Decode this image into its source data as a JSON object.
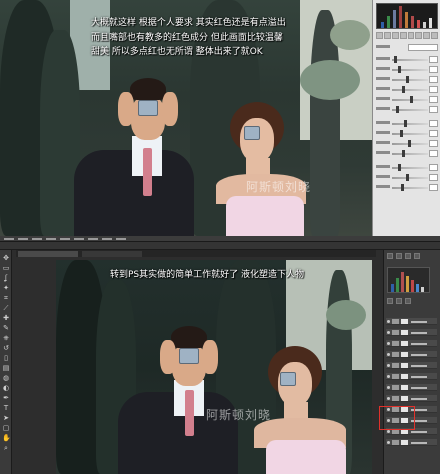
{
  "camera_raw": {
    "caption_lines": [
      "大概就这样  根据个人要求  其实红色还是有点溢出",
      "而且嘴部也有教多的红色成分  但此画面比较温馨",
      "甜美  所以多点红也无所谓  整体出来了就OK"
    ],
    "watermark": "阿斯顿刘晓",
    "panel_slider_count": 13
  },
  "photoshop": {
    "caption": "转到PS其实做的简单工作就好了  液化塑造下人物",
    "watermark": "阿斯顿刘晓",
    "tools": [
      "move-icon",
      "marquee-icon",
      "lasso-icon",
      "wand-icon",
      "crop-icon",
      "eyedropper-icon",
      "heal-icon",
      "brush-icon",
      "stamp-icon",
      "history-brush-icon",
      "eraser-icon",
      "gradient-icon",
      "blur-icon",
      "dodge-icon",
      "pen-icon",
      "text-icon",
      "path-select-icon",
      "shape-icon",
      "hand-icon",
      "zoom-icon"
    ],
    "tool_glyphs": [
      "✥",
      "▭",
      "ʆ",
      "✦",
      "⌗",
      "⟋",
      "✚",
      "✎",
      "⎈",
      "↺",
      "▯",
      "▤",
      "◍",
      "◐",
      "✒",
      "T",
      "➤",
      "▢",
      "✋",
      "⌕"
    ],
    "layers_count": 12
  },
  "colors": {
    "highlight_box": "#e0312b",
    "panel_light": "#e4e4e4",
    "panel_dark": "#3b3b3b"
  }
}
